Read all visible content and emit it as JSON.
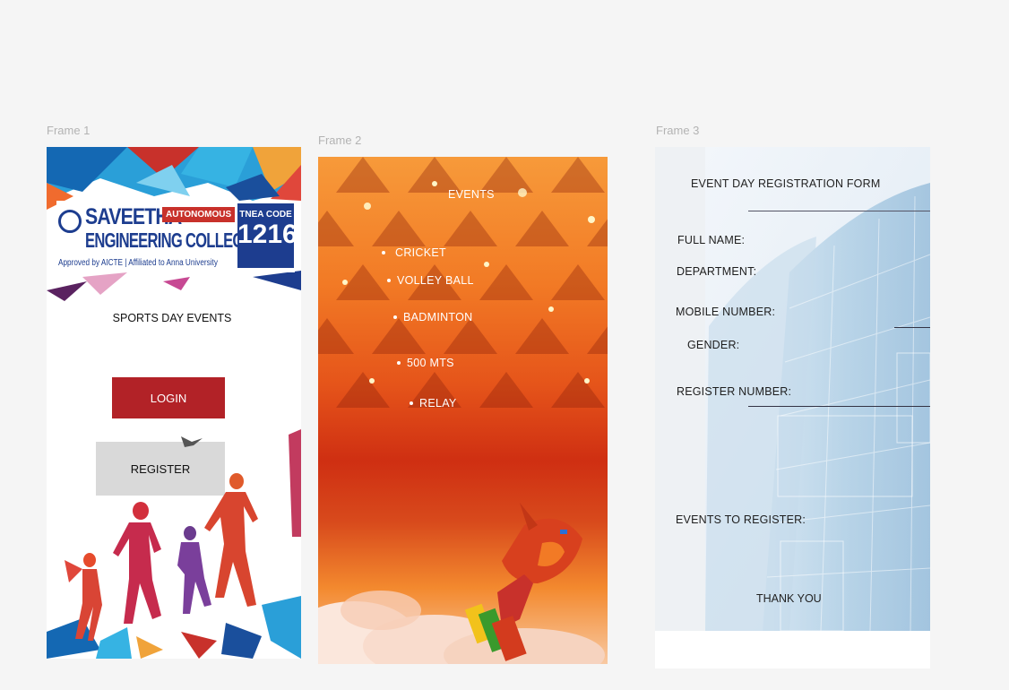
{
  "canvas": {
    "frames": [
      {
        "label": "Frame 1"
      },
      {
        "label": "Frame 2"
      },
      {
        "label": "Frame 3"
      }
    ]
  },
  "frame1": {
    "logo": {
      "college_line1": "SAVEETHA",
      "college_line2": "ENGINEERING COLLEGE",
      "autonomous": "AUTONOMOUS",
      "tnea_label": "TNEA CODE",
      "tnea_code": "1216",
      "approval": "Approved by AICTE | Affiliated to Anna University"
    },
    "title": "SPORTS DAY EVENTS",
    "login_label": "LOGIN",
    "register_label": "REGISTER",
    "colors": {
      "login": "#b22227",
      "register": "#d9d9d9",
      "brand_blue": "#1d3d8f"
    }
  },
  "frame2": {
    "title": "EVENTS",
    "events": [
      "CRICKET",
      "VOLLEY BALL",
      "BADMINTON",
      "500 MTS",
      "RELAY"
    ]
  },
  "frame3": {
    "title": "EVENT DAY REGISTRATION FORM",
    "fields": {
      "full_name": "FULL NAME:",
      "department": "DEPARTMENT:",
      "mobile": "MOBILE NUMBER:",
      "gender": "GENDER:",
      "register_number": "REGISTER NUMBER:",
      "events": "EVENTS TO REGISTER:"
    },
    "footer": "THANK YOU"
  }
}
